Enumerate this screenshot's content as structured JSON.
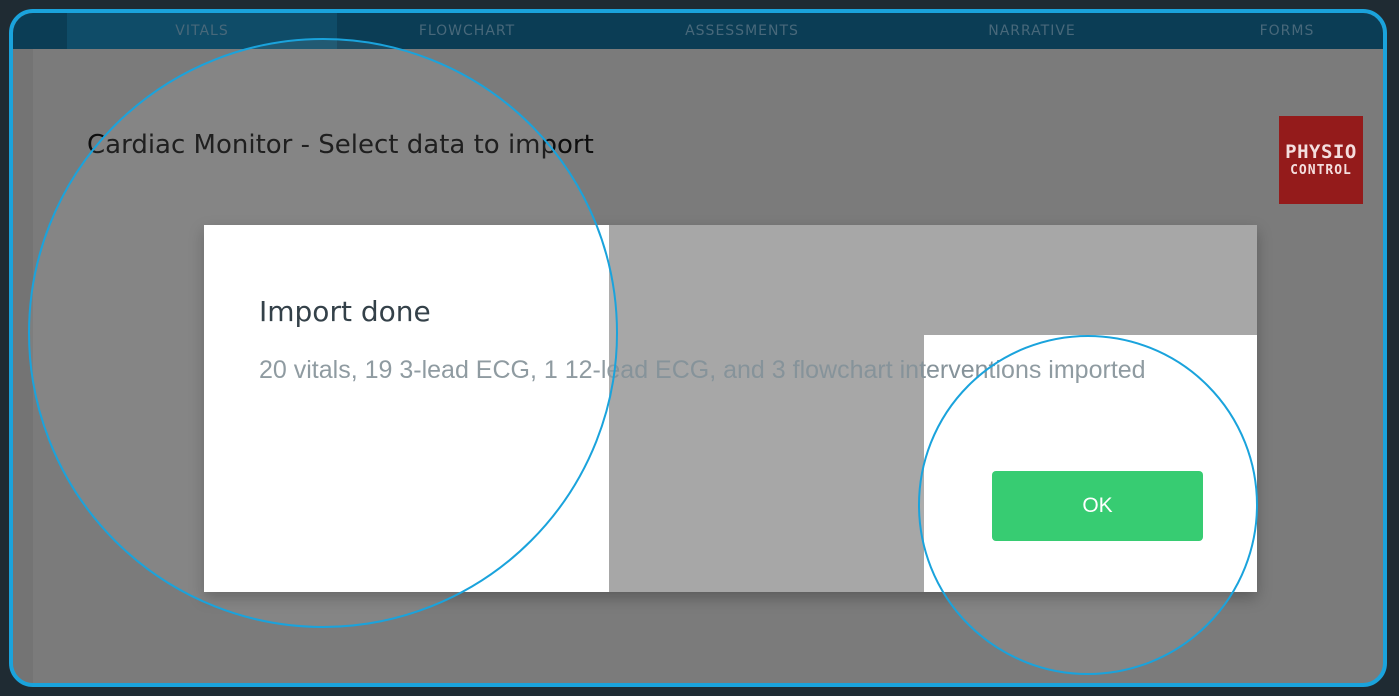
{
  "tabs": [
    {
      "label": "VITALS",
      "active": true
    },
    {
      "label": "FLOWCHART",
      "active": false
    },
    {
      "label": "ASSESSMENTS",
      "active": false
    },
    {
      "label": "NARRATIVE",
      "active": false
    },
    {
      "label": "FORMS",
      "active": false
    }
  ],
  "header": {
    "title": "Cardiac Monitor - Select data to import",
    "brand_line1": "PHYSIO",
    "brand_line2": "CONTROL"
  },
  "dialog": {
    "title": "Import done",
    "message": "20 vitals, 19 3-lead ECG, 1 12-lead ECG, and 3 flowchart interventions imported",
    "ok_label": "OK"
  },
  "colors": {
    "tab_bar": "#0b3d55",
    "overlay": "#7b7b7b",
    "brand": "#941b1b",
    "ok_button": "#27c867",
    "highlight_ring": "#1aa3dc"
  }
}
